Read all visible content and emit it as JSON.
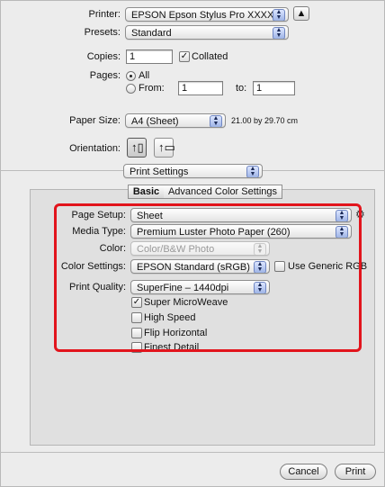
{
  "printer": {
    "label": "Printer:",
    "value": "EPSON Epson Stylus Pro XXXX"
  },
  "presets": {
    "label": "Presets:",
    "value": "Standard"
  },
  "copies": {
    "label": "Copies:",
    "value": "1",
    "collated_label": "Collated",
    "collated_checked": true
  },
  "pages": {
    "label": "Pages:",
    "all_label": "All",
    "from_label": "From:",
    "from_value": "1",
    "to_label": "to:",
    "to_value": "1",
    "selected": "All"
  },
  "paper_size": {
    "label": "Paper Size:",
    "value": "A4 (Sheet)",
    "dimensions": "21.00 by 29.70 cm"
  },
  "orientation": {
    "label": "Orientation:",
    "selected": "portrait"
  },
  "section": {
    "value": "Print Settings"
  },
  "tabs": [
    {
      "label": "Basic",
      "active": true
    },
    {
      "label": "Advanced Color Settings",
      "active": false
    }
  ],
  "settings": {
    "page_setup": {
      "label": "Page Setup:",
      "value": "Sheet"
    },
    "media_type": {
      "label": "Media Type:",
      "value": "Premium Luster Photo Paper (260)"
    },
    "color": {
      "label": "Color:",
      "value": "Color/B&W Photo",
      "disabled": true
    },
    "color_settings": {
      "label": "Color Settings:",
      "value": "EPSON Standard (sRGB)",
      "generic_rgb_label": "Use Generic RGB",
      "generic_rgb_checked": false
    },
    "print_quality": {
      "label": "Print Quality:",
      "value": "SuperFine – 1440dpi"
    },
    "options": [
      {
        "label": "Super MicroWeave",
        "checked": true
      },
      {
        "label": "High Speed",
        "checked": false
      },
      {
        "label": "Flip Horizontal",
        "checked": false
      },
      {
        "label": "Finest Detail",
        "checked": false
      }
    ]
  },
  "buttons": {
    "cancel": "Cancel",
    "print": "Print"
  },
  "colors": {
    "highlight_border": "#e2141c",
    "popup_arrow": "#9eb4e6"
  }
}
